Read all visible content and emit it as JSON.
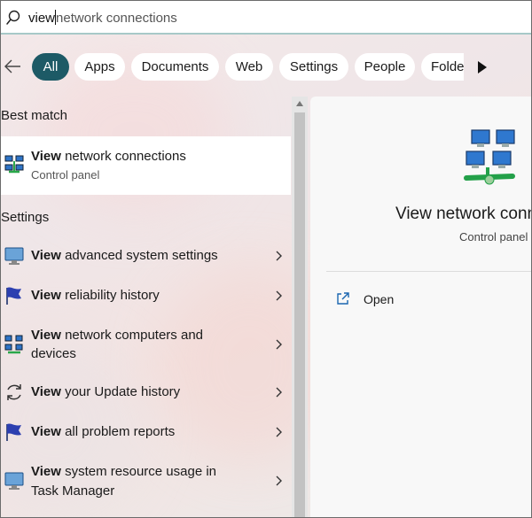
{
  "search": {
    "typed": "view",
    "suggestion": "network connections"
  },
  "filters": [
    {
      "label": "All",
      "active": true
    },
    {
      "label": "Apps"
    },
    {
      "label": "Documents"
    },
    {
      "label": "Web"
    },
    {
      "label": "Settings"
    },
    {
      "label": "People"
    },
    {
      "label": "Folde"
    }
  ],
  "best_match": {
    "heading": "Best match",
    "bold": "View",
    "rest": " network connections",
    "subtitle": "Control panel"
  },
  "settings": {
    "heading": "Settings",
    "items": [
      {
        "bold": "View",
        "line1": " advanced system settings",
        "line2": "",
        "icon": "monitor-icon"
      },
      {
        "bold": "View",
        "line1": " reliability history",
        "line2": "",
        "icon": "flag-icon"
      },
      {
        "bold": "View",
        "line1": " network computers and",
        "line2": "devices",
        "icon": "network-computers-icon"
      },
      {
        "bold": "View",
        "line1": " your Update history",
        "line2": "",
        "icon": "refresh-icon"
      },
      {
        "bold": "View",
        "line1": " all problem reports",
        "line2": "",
        "icon": "flag-icon"
      },
      {
        "bold": "View",
        "line1": " system resource usage in",
        "line2": "Task Manager",
        "icon": "monitor-icon"
      }
    ]
  },
  "preview": {
    "title": "View network connections",
    "subtitle": "Control panel",
    "action": "Open"
  },
  "colors": {
    "accent": "#1d5a66",
    "search_border": "#a7c9c8",
    "link_blue": "#1a66b0"
  }
}
